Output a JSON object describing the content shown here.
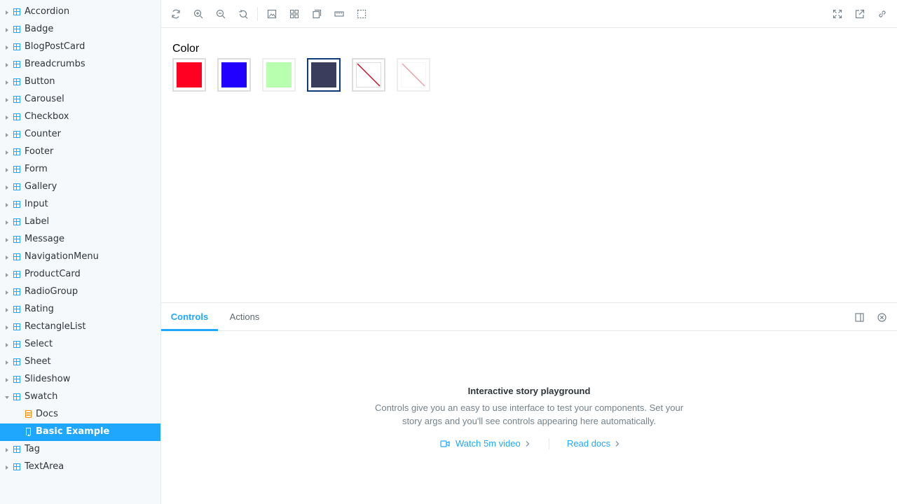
{
  "sidebar": {
    "items": [
      {
        "label": "Accordion"
      },
      {
        "label": "Badge"
      },
      {
        "label": "BlogPostCard"
      },
      {
        "label": "Breadcrumbs"
      },
      {
        "label": "Button"
      },
      {
        "label": "Carousel"
      },
      {
        "label": "Checkbox"
      },
      {
        "label": "Counter"
      },
      {
        "label": "Footer"
      },
      {
        "label": "Form"
      },
      {
        "label": "Gallery"
      },
      {
        "label": "Input"
      },
      {
        "label": "Label"
      },
      {
        "label": "Message"
      },
      {
        "label": "NavigationMenu"
      },
      {
        "label": "ProductCard"
      },
      {
        "label": "RadioGroup"
      },
      {
        "label": "Rating"
      },
      {
        "label": "RectangleList"
      },
      {
        "label": "Select"
      },
      {
        "label": "Sheet"
      },
      {
        "label": "Slideshow"
      },
      {
        "label": "Swatch"
      },
      {
        "label": "Docs"
      },
      {
        "label": "Basic Example"
      },
      {
        "label": "Tag"
      },
      {
        "label": "TextArea"
      }
    ]
  },
  "canvas": {
    "title": "Color",
    "swatches": [
      {
        "color": "#ff0022"
      },
      {
        "color": "#2200ff"
      },
      {
        "color": "#b8ffb0"
      },
      {
        "color": "#3b3d5c"
      },
      {
        "color": "#ffffff"
      },
      {
        "color": "#ffffff"
      }
    ]
  },
  "panel": {
    "tabs": {
      "controls": "Controls",
      "actions": "Actions"
    },
    "empty_title": "Interactive story playground",
    "empty_desc": "Controls give you an easy to use interface to test your components. Set your story args and you'll see controls appearing here automatically.",
    "watch_video": "Watch 5m video",
    "read_docs": "Read docs"
  },
  "colors": {
    "accent": "#1ea7fd",
    "selected_border": "#0d3b7a"
  }
}
